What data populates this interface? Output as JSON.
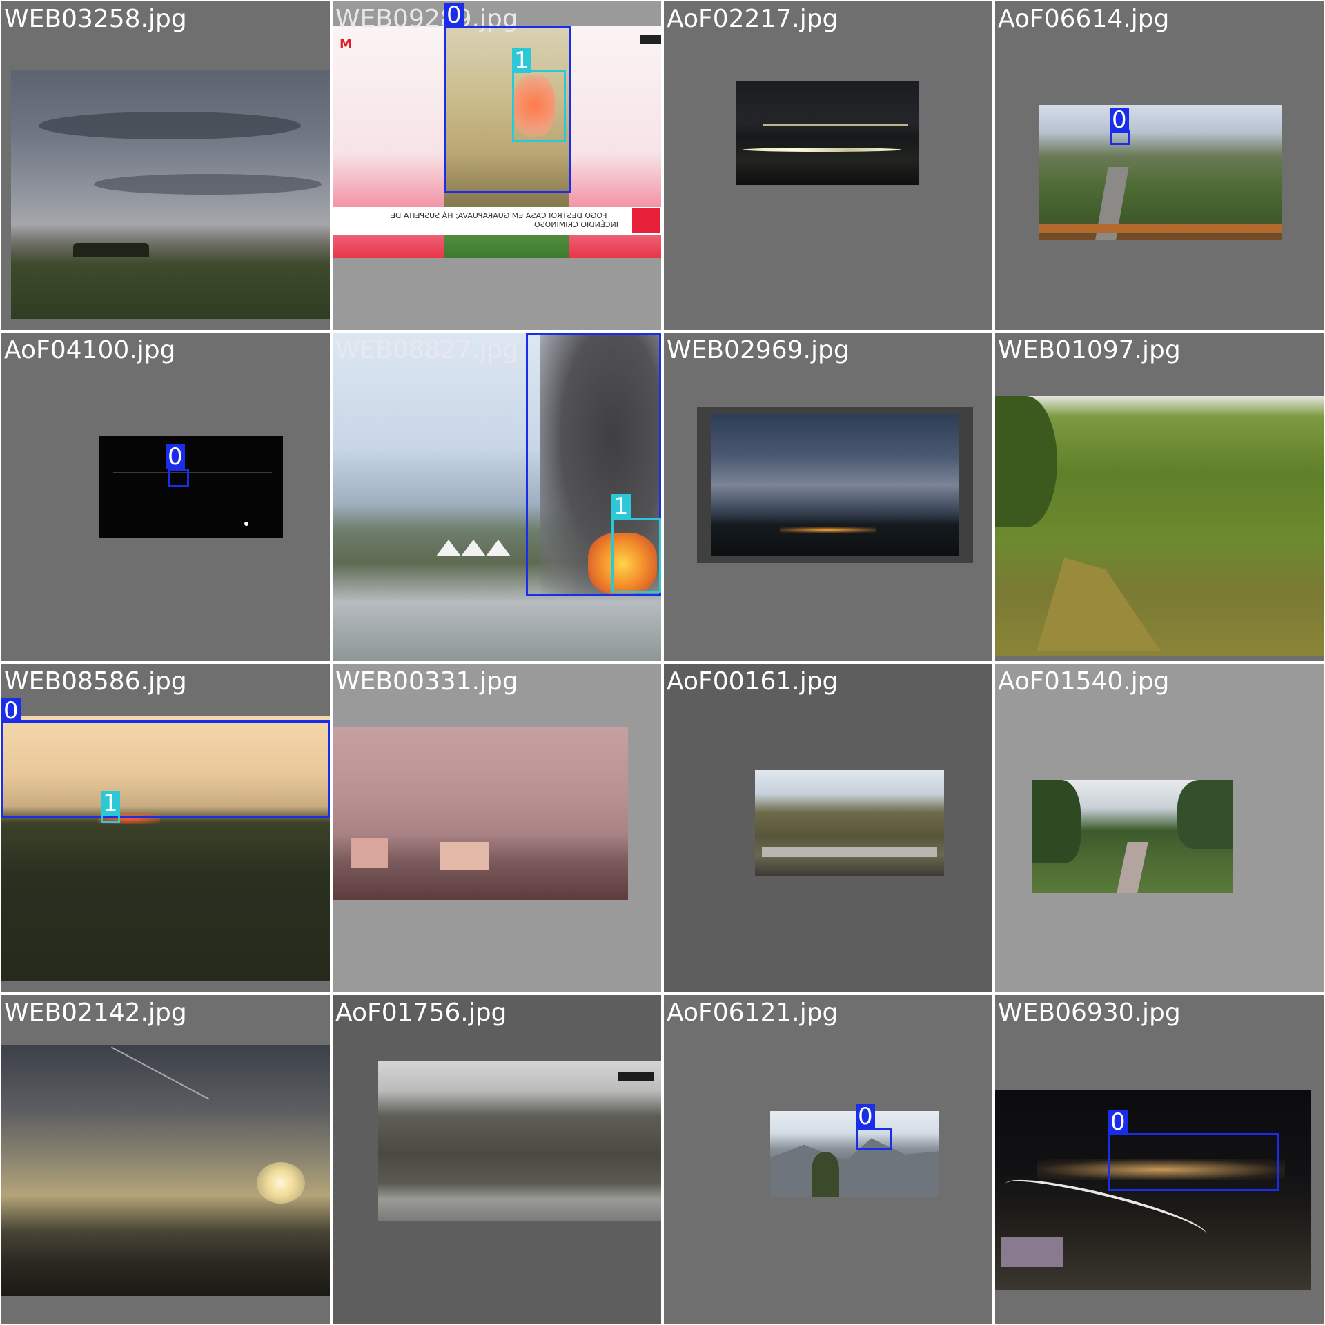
{
  "grid": {
    "tiles": [
      {
        "filename": "WEB03258.jpg",
        "background": "#6f6f6f",
        "scene": "cloudy-grassland"
      },
      {
        "filename": "WEB09289.jpg",
        "background": "#9a9a9a",
        "scene": "news-fire",
        "news_headline_1": "FOGO DESTROI CASA EM GUARAPUAVA; HÁ SUSPEITA DE",
        "news_headline_2": "INCÊNDIO CRIMINOSO",
        "boxes": [
          {
            "cls": "0"
          },
          {
            "cls": "1"
          }
        ]
      },
      {
        "filename": "AoF02217.jpg",
        "background": "#6f6f6f",
        "scene": "night-lakeshore"
      },
      {
        "filename": "AoF06614.jpg",
        "background": "#6f6f6f",
        "scene": "city-valley",
        "boxes": [
          {
            "cls": "0"
          }
        ]
      },
      {
        "filename": "AoF04100.jpg",
        "background": "#6f6f6f",
        "scene": "night-dark",
        "boxes": [
          {
            "cls": "0"
          }
        ]
      },
      {
        "filename": "WEB08827.jpg",
        "background": "#9a9a9a",
        "scene": "city-smoke-fire",
        "boxes": [
          {
            "cls": "0"
          },
          {
            "cls": "1"
          }
        ]
      },
      {
        "filename": "WEB02969.jpg",
        "background": "#6f6f6f",
        "scene": "night-clouds"
      },
      {
        "filename": "WEB01097.jpg",
        "background": "#6f6f6f",
        "scene": "green-hillside"
      },
      {
        "filename": "WEB08586.jpg",
        "background": "#6f6f6f",
        "scene": "forest-smoke",
        "boxes": [
          {
            "cls": "0"
          },
          {
            "cls": "1"
          }
        ]
      },
      {
        "filename": "WEB00331.jpg",
        "background": "#9a9a9a",
        "scene": "pink-haze-buildings"
      },
      {
        "filename": "AoF00161.jpg",
        "background": "#5e5e5e",
        "scene": "dry-hills"
      },
      {
        "filename": "AoF01540.jpg",
        "background": "#9a9a9a",
        "scene": "park-road"
      },
      {
        "filename": "WEB02142.jpg",
        "background": "#6f6f6f",
        "scene": "sunset-city"
      },
      {
        "filename": "AoF01756.jpg",
        "background": "#5e5e5e",
        "scene": "grey-hills"
      },
      {
        "filename": "AoF06121.jpg",
        "background": "#6f6f6f",
        "scene": "mountain-snow",
        "boxes": [
          {
            "cls": "0"
          }
        ]
      },
      {
        "filename": "WEB06930.jpg",
        "background": "#6f6f6f",
        "scene": "night-highway",
        "boxes": [
          {
            "cls": "0"
          }
        ]
      }
    ]
  }
}
